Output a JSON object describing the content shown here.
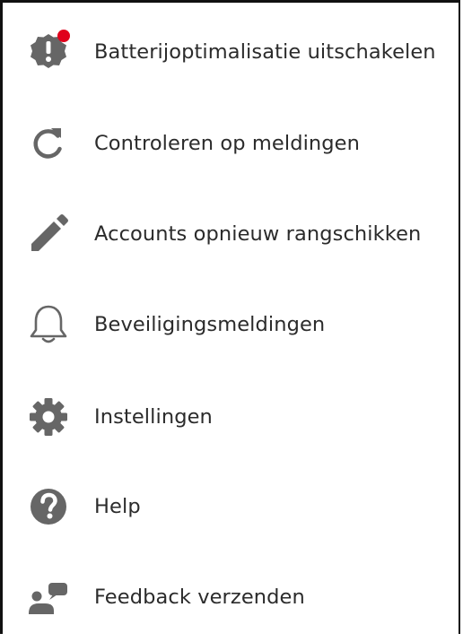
{
  "menu": {
    "items": [
      {
        "label": "Batterijoptimalisatie uitschakelen",
        "icon": "battery-warning-badge-icon",
        "has_notification_dot": true
      },
      {
        "label": "Controleren op meldingen",
        "icon": "refresh-icon"
      },
      {
        "label": "Accounts opnieuw rangschikken",
        "icon": "pencil-icon"
      },
      {
        "label": "Beveiligingsmeldingen",
        "icon": "bell-icon"
      },
      {
        "label": "Instellingen",
        "icon": "gear-icon"
      },
      {
        "label": "Help",
        "icon": "help-circle-icon"
      },
      {
        "label": "Feedback verzenden",
        "icon": "feedback-icon"
      }
    ]
  },
  "colors": {
    "icon": "#666666",
    "text": "#2b2b2b",
    "notification_dot": "#e0001b",
    "border": "#111111",
    "background": "#ffffff"
  }
}
